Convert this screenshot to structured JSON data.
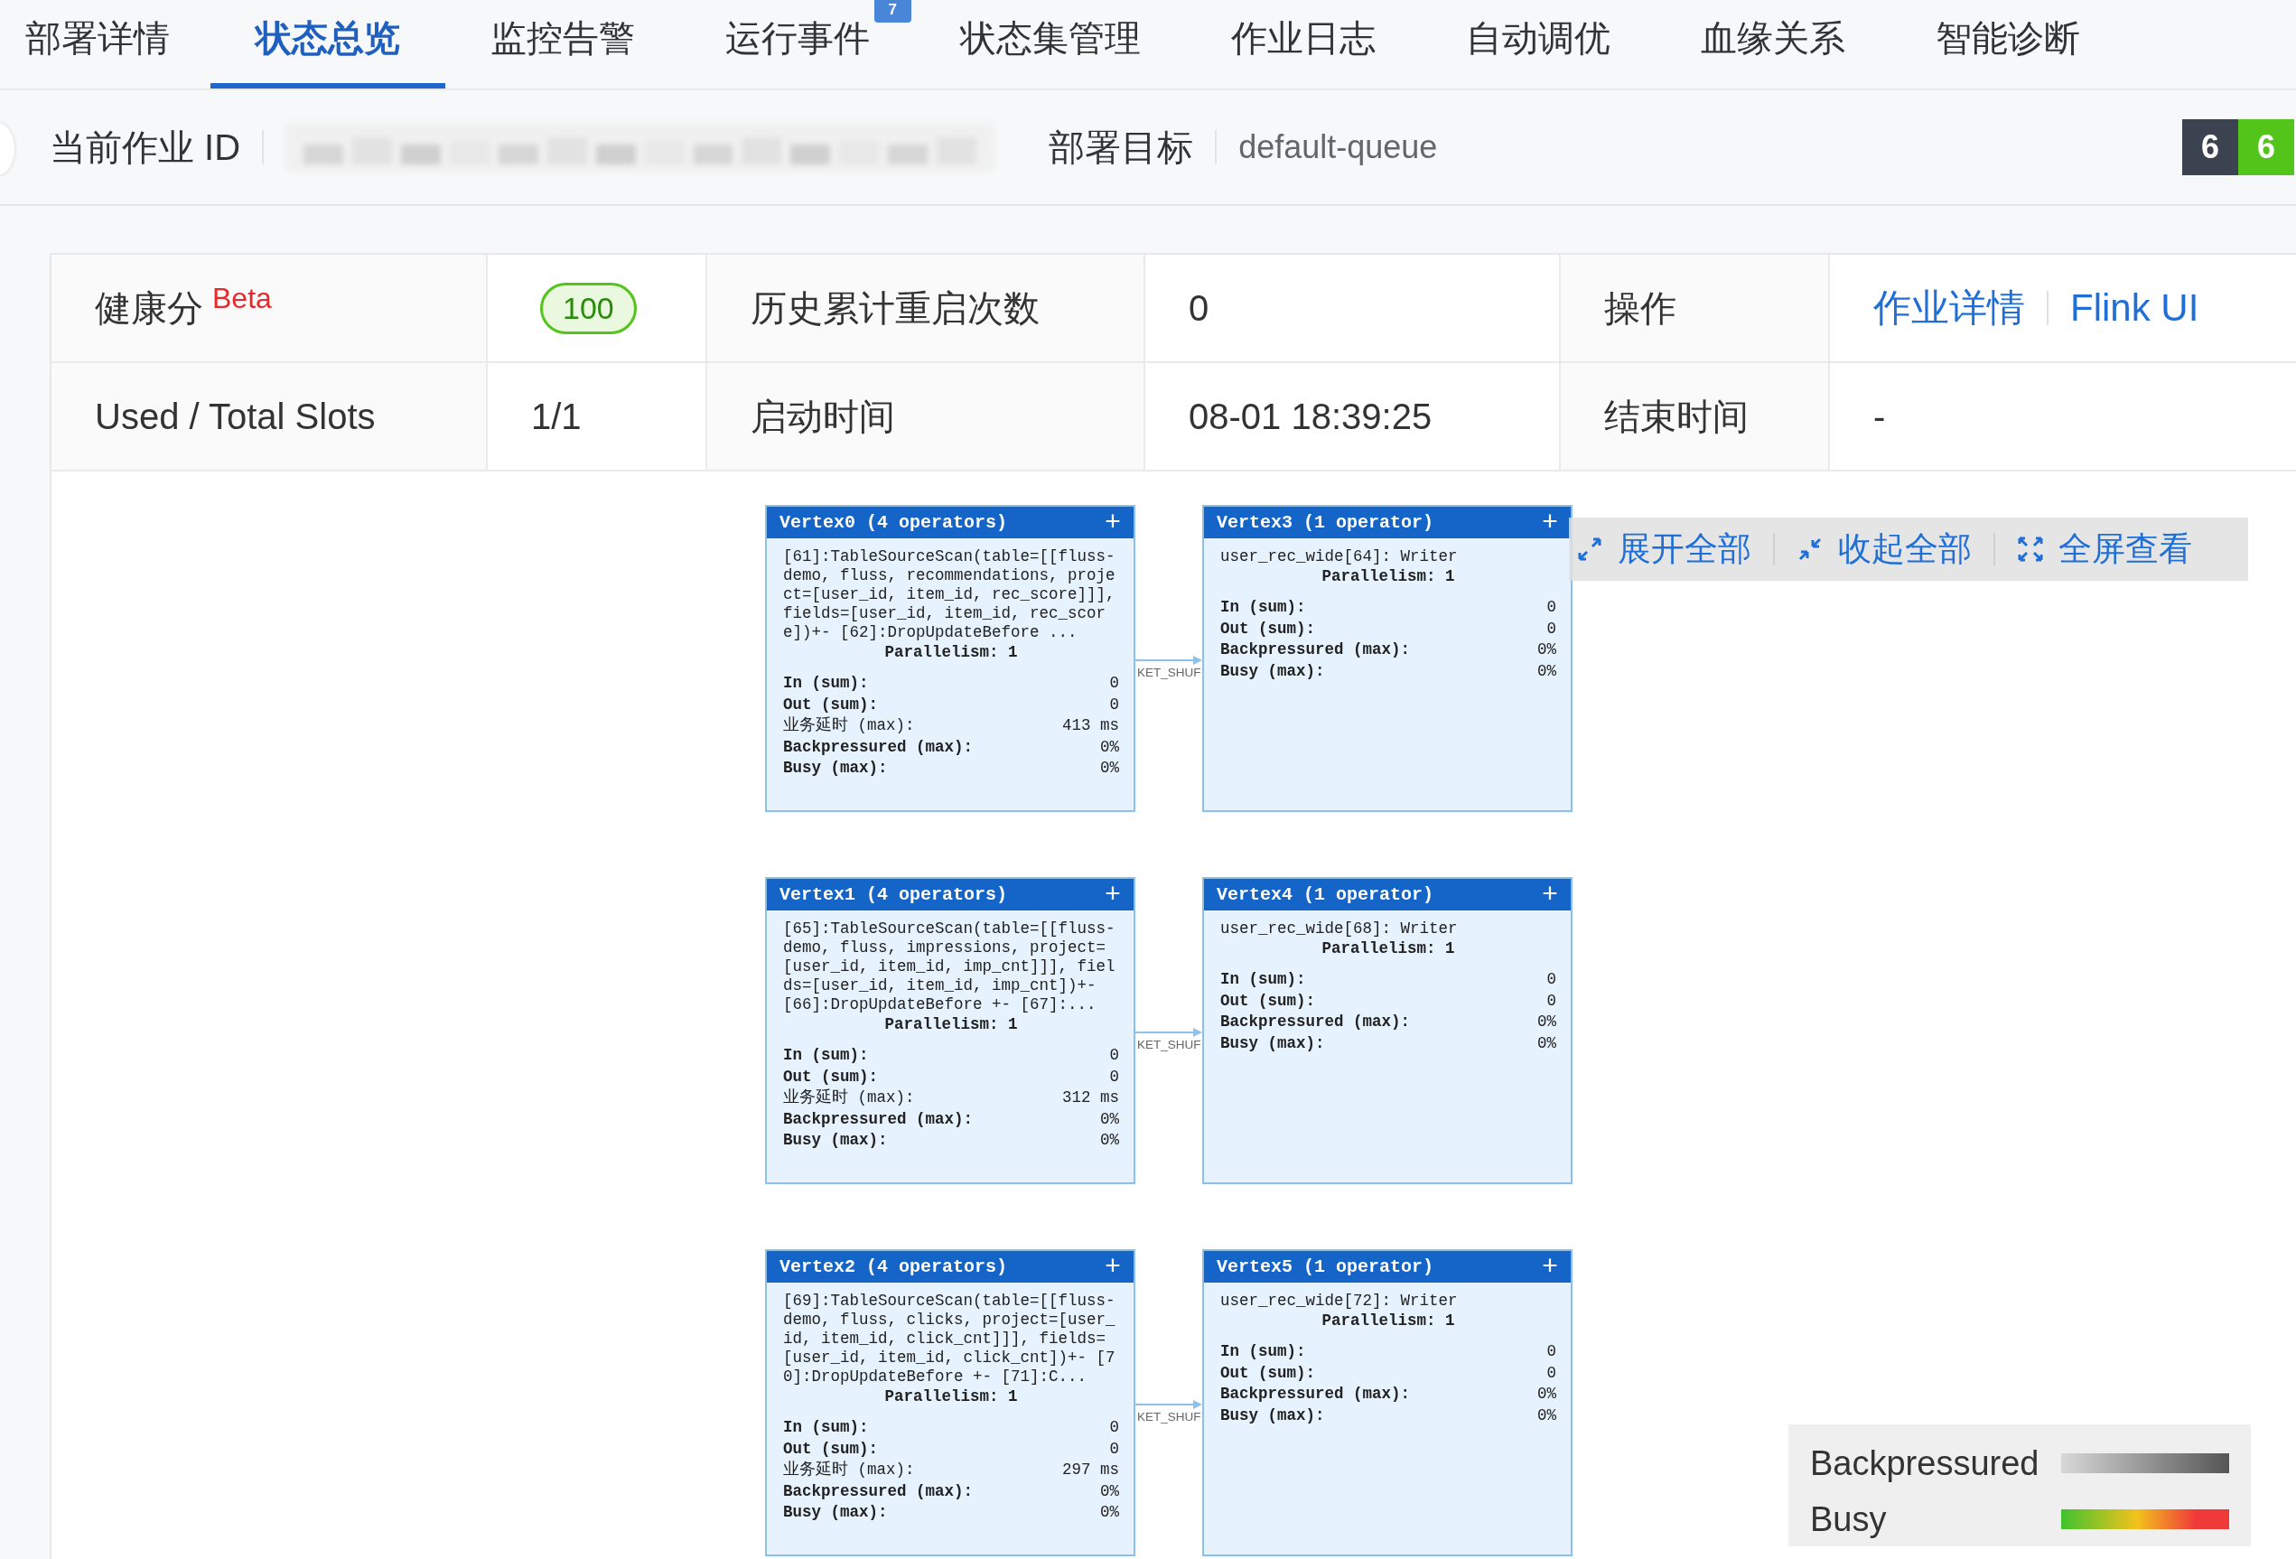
{
  "tabs": [
    {
      "label": "部署详情",
      "selected": false
    },
    {
      "label": "状态总览",
      "selected": true
    },
    {
      "label": "监控告警",
      "selected": false
    },
    {
      "label": "运行事件",
      "selected": false,
      "badge": "7"
    },
    {
      "label": "状态集管理",
      "selected": false
    },
    {
      "label": "作业日志",
      "selected": false
    },
    {
      "label": "自动调优",
      "selected": false
    },
    {
      "label": "血缘关系",
      "selected": false
    },
    {
      "label": "智能诊断",
      "selected": false
    }
  ],
  "job_info": {
    "id_label": "当前作业 ID",
    "target_label": "部署目标",
    "target_value": "default-queue",
    "counters": [
      {
        "value": "6",
        "color": "#3c4350"
      },
      {
        "value": "6",
        "color": "#52c41a"
      }
    ]
  },
  "summary": {
    "rows": [
      [
        {
          "kind": "label",
          "text": "健康分",
          "tag": "Beta"
        },
        {
          "kind": "score",
          "text": "100"
        },
        {
          "kind": "label",
          "text": "历史累计重启次数"
        },
        {
          "kind": "value",
          "text": "0"
        },
        {
          "kind": "label",
          "text": "操作"
        },
        {
          "kind": "links",
          "links": [
            "作业详情",
            "Flink UI"
          ]
        }
      ],
      [
        {
          "kind": "label",
          "text": "Used / Total Slots"
        },
        {
          "kind": "value",
          "text": "1/1"
        },
        {
          "kind": "label",
          "text": "启动时间"
        },
        {
          "kind": "value",
          "text": "08-01 18:39:25"
        },
        {
          "kind": "label",
          "text": "结束时间"
        },
        {
          "kind": "value",
          "text": "-"
        }
      ]
    ]
  },
  "graph": {
    "rows": [
      {
        "left": {
          "title": "Vertex0 (4 operators)",
          "expand": "+",
          "description": "[61]:TableSourceScan(table=[[fluss-demo, fluss, recommendations, project=[user_id, item_id, rec_score]]], fields=[user_id, item_id, rec_score])+- [62]:DropUpdateBefore ...",
          "parallelism": "Parallelism: 1",
          "metrics": [
            {
              "kind": "metric",
              "label": "In (sum):",
              "value": "0"
            },
            {
              "kind": "metric",
              "label": "Out (sum):",
              "value": "0"
            },
            {
              "kind": "latency",
              "label": "业务延时 (max):",
              "value": "413 ms"
            },
            {
              "kind": "metric",
              "label": "Backpressured (max):",
              "value": "0%"
            },
            {
              "kind": "metric",
              "label": "Busy (max):",
              "value": "0%"
            }
          ]
        },
        "edge_label": "KET_SHUF",
        "right": {
          "title": "Vertex3 (1 operator)",
          "expand": "+",
          "description": "user_rec_wide[64]: Writer",
          "parallelism": "Parallelism: 1",
          "metrics": [
            {
              "kind": "metric",
              "label": "In (sum):",
              "value": "0"
            },
            {
              "kind": "metric",
              "label": "Out (sum):",
              "value": "0"
            },
            {
              "kind": "metric",
              "label": "Backpressured (max):",
              "value": "0%"
            },
            {
              "kind": "metric",
              "label": "Busy (max):",
              "value": "0%"
            }
          ]
        }
      },
      {
        "left": {
          "title": "Vertex1 (4 operators)",
          "expand": "+",
          "description": "[65]:TableSourceScan(table=[[fluss-demo, fluss, impressions, project=[user_id, item_id, imp_cnt]]], fields=[user_id, item_id, imp_cnt])+- [66]:DropUpdateBefore +- [67]:...",
          "parallelism": "Parallelism: 1",
          "metrics": [
            {
              "kind": "metric",
              "label": "In (sum):",
              "value": "0"
            },
            {
              "kind": "metric",
              "label": "Out (sum):",
              "value": "0"
            },
            {
              "kind": "latency",
              "label": "业务延时 (max):",
              "value": "312 ms"
            },
            {
              "kind": "metric",
              "label": "Backpressured (max):",
              "value": "0%"
            },
            {
              "kind": "metric",
              "label": "Busy (max):",
              "value": "0%"
            }
          ]
        },
        "edge_label": "KET_SHUF",
        "right": {
          "title": "Vertex4 (1 operator)",
          "expand": "+",
          "description": "user_rec_wide[68]: Writer",
          "parallelism": "Parallelism: 1",
          "metrics": [
            {
              "kind": "metric",
              "label": "In (sum):",
              "value": "0"
            },
            {
              "kind": "metric",
              "label": "Out (sum):",
              "value": "0"
            },
            {
              "kind": "metric",
              "label": "Backpressured (max):",
              "value": "0%"
            },
            {
              "kind": "metric",
              "label": "Busy (max):",
              "value": "0%"
            }
          ]
        }
      },
      {
        "left": {
          "title": "Vertex2 (4 operators)",
          "expand": "+",
          "description": "[69]:TableSourceScan(table=[[fluss-demo, fluss, clicks, project=[user_id, item_id, click_cnt]]], fields=[user_id, item_id, click_cnt])+- [70]:DropUpdateBefore +- [71]:C...",
          "parallelism": "Parallelism: 1",
          "metrics": [
            {
              "kind": "metric",
              "label": "In (sum):",
              "value": "0"
            },
            {
              "kind": "metric",
              "label": "Out (sum):",
              "value": "0"
            },
            {
              "kind": "latency",
              "label": "业务延时 (max):",
              "value": "297 ms"
            },
            {
              "kind": "metric",
              "label": "Backpressured (max):",
              "value": "0%"
            },
            {
              "kind": "metric",
              "label": "Busy (max):",
              "value": "0%"
            }
          ]
        },
        "edge_label": "KET_SHUF",
        "right": {
          "title": "Vertex5 (1 operator)",
          "expand": "+",
          "description": "user_rec_wide[72]: Writer",
          "parallelism": "Parallelism: 1",
          "metrics": [
            {
              "kind": "metric",
              "label": "In (sum):",
              "value": "0"
            },
            {
              "kind": "metric",
              "label": "Out (sum):",
              "value": "0"
            },
            {
              "kind": "metric",
              "label": "Backpressured (max):",
              "value": "0%"
            },
            {
              "kind": "metric",
              "label": "Busy (max):",
              "value": "0%"
            }
          ]
        }
      }
    ]
  },
  "toolbar": [
    {
      "kind": "expand",
      "label": "展开全部"
    },
    {
      "kind": "collapse",
      "label": "收起全部"
    },
    {
      "kind": "fullscreen",
      "label": "全屏查看"
    }
  ],
  "legend": [
    {
      "kind": "backpressure",
      "label": "Backpressured"
    },
    {
      "kind": "busy",
      "label": "Busy"
    }
  ]
}
